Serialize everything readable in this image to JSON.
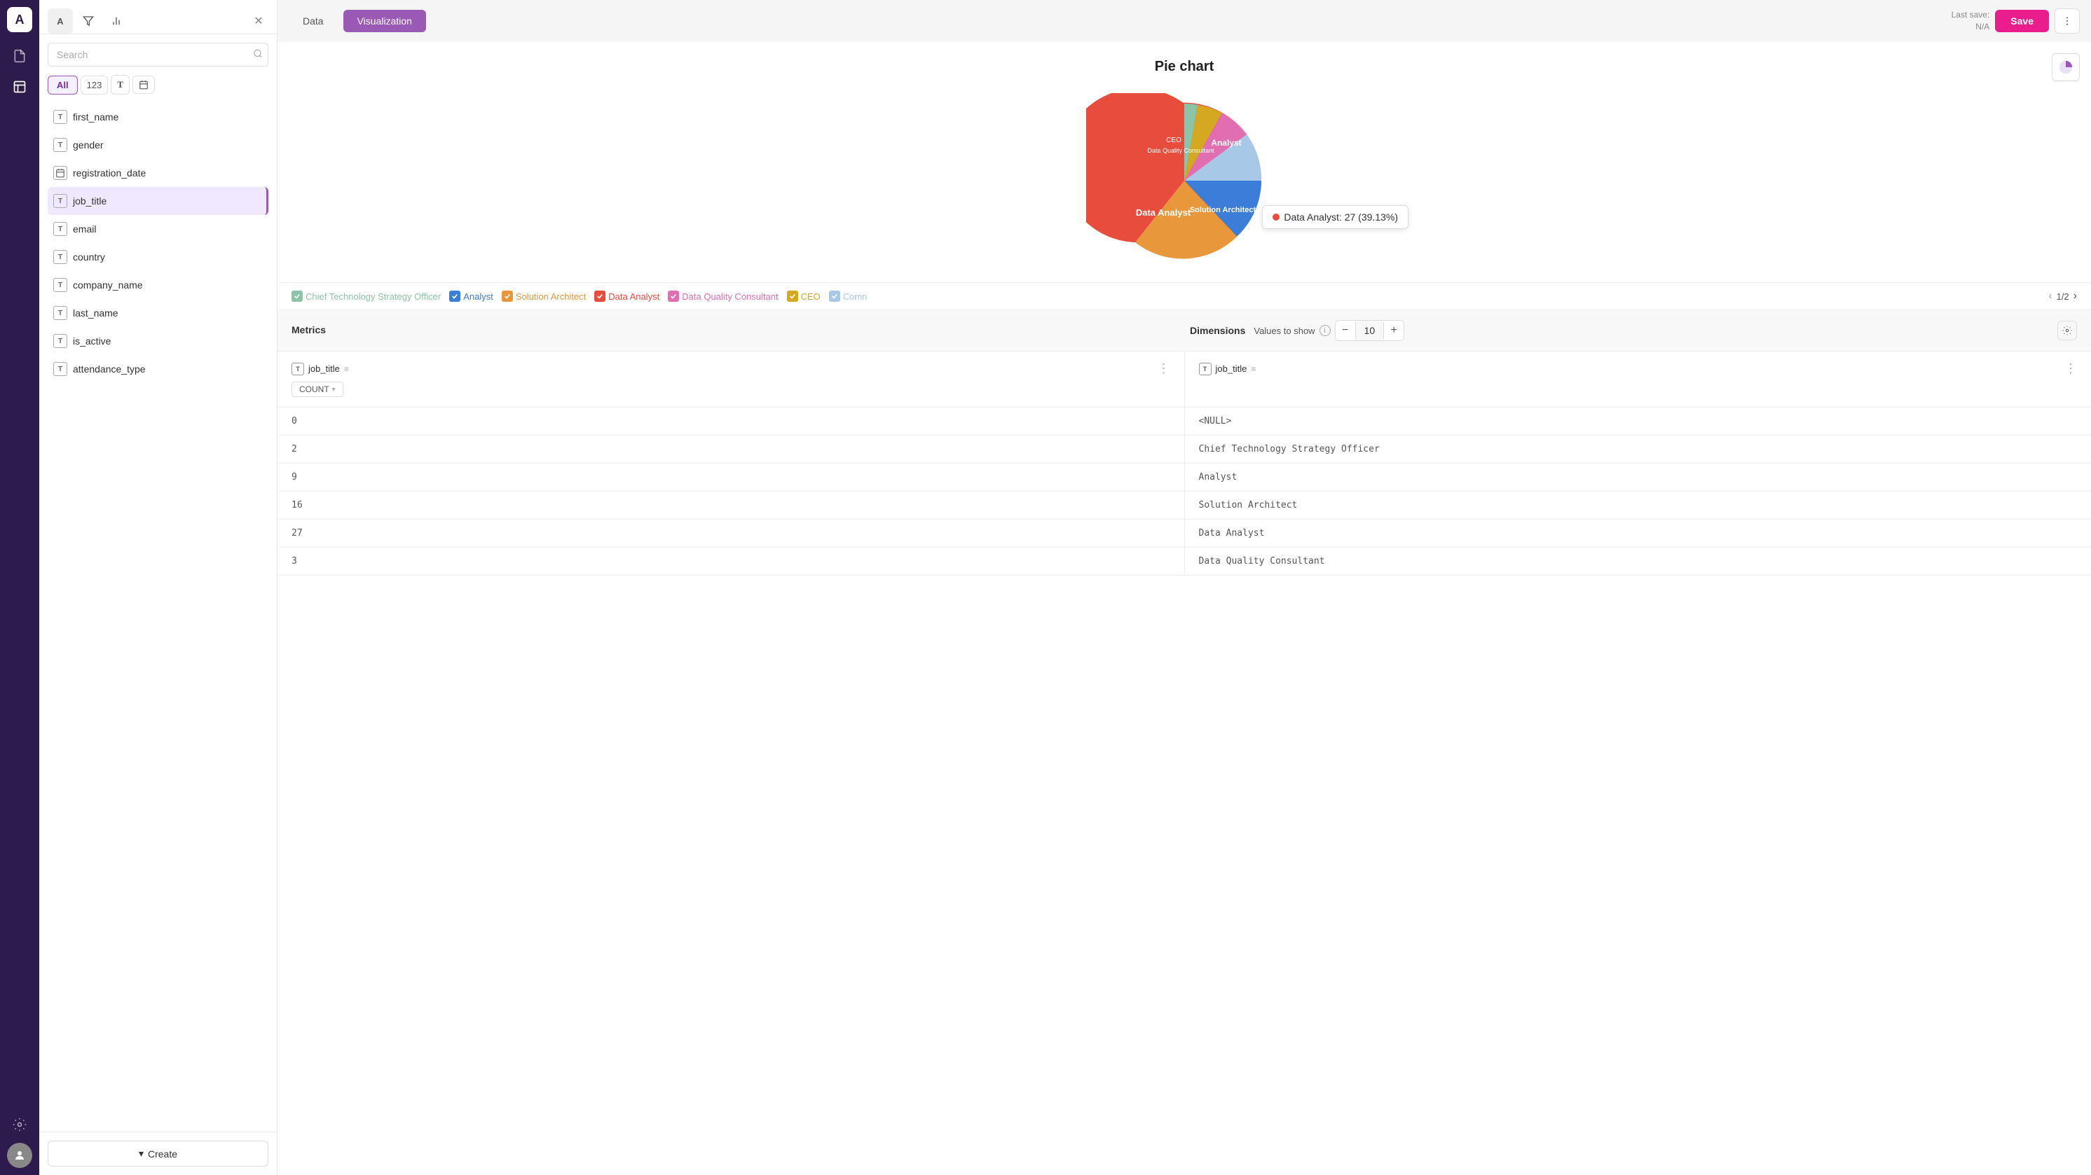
{
  "app": {
    "logo": "A"
  },
  "sidebar": {
    "search_placeholder": "Search",
    "filter_tabs": [
      {
        "label": "All",
        "active": true
      },
      {
        "label": "123",
        "type": "number"
      },
      {
        "label": "T",
        "type": "text"
      },
      {
        "label": "📅",
        "type": "date"
      }
    ],
    "fields": [
      {
        "name": "first_name",
        "type": "T"
      },
      {
        "name": "gender",
        "type": "T"
      },
      {
        "name": "registration_date",
        "type": "date"
      },
      {
        "name": "job_title",
        "type": "T",
        "selected": true
      },
      {
        "name": "email",
        "type": "T"
      },
      {
        "name": "country",
        "type": "T"
      },
      {
        "name": "company_name",
        "type": "T"
      },
      {
        "name": "last_name",
        "type": "T"
      },
      {
        "name": "is_active",
        "type": "T"
      },
      {
        "name": "attendance_type",
        "type": "T"
      }
    ],
    "create_label": "Create"
  },
  "topbar": {
    "tabs": [
      {
        "label": "Data",
        "active": false
      },
      {
        "label": "Visualization",
        "active": true
      }
    ],
    "last_save_label": "Last save:",
    "last_save_value": "N/A",
    "save_label": "Save"
  },
  "chart": {
    "title": "Pie chart",
    "tooltip": "Data Analyst: 27 (39.13%)",
    "segments": [
      {
        "label": "Analyst",
        "color": "#3b7dd8",
        "percentage": 13
      },
      {
        "label": "Solution Architect",
        "color": "#e8973b",
        "percentage": 23
      },
      {
        "label": "Data Analyst",
        "color": "#e74c3c",
        "percentage": 39
      },
      {
        "label": "Data Quality Consultant",
        "color": "#e74c9e",
        "percentage": 7
      },
      {
        "label": "CEO",
        "color": "#c0a020",
        "percentage": 5
      },
      {
        "label": "Chief Technology Strategy Officer",
        "color": "#8bc4a8",
        "percentage": 3
      },
      {
        "label": "Comn",
        "color": "#b0c8e8",
        "percentage": 10
      }
    ],
    "legend": [
      {
        "label": "Chief Technology Strategy Officer",
        "color": "#8bc4a8",
        "checked": true
      },
      {
        "label": "Analyst",
        "color": "#3b7dd8",
        "checked": true
      },
      {
        "label": "Solution Architect",
        "color": "#e8973b",
        "checked": true
      },
      {
        "label": "Data Analyst",
        "color": "#e74c3c",
        "checked": true
      },
      {
        "label": "Data Quality Consultant",
        "color": "#e74c9e",
        "checked": true
      },
      {
        "label": "CEO",
        "color": "#c0a020",
        "checked": true
      },
      {
        "label": "Comn",
        "color": "#b0c8e8",
        "checked": true
      }
    ],
    "pagination": "1/2"
  },
  "metrics_panel": {
    "metrics_label": "Metrics",
    "dimensions_label": "Dimensions",
    "values_to_show_label": "Values to show",
    "values_count": "10",
    "metric_field": "job_title",
    "metric_agg": "COUNT",
    "dimension_field": "job_title",
    "rows": [
      {
        "metric": "0",
        "dimension": "<NULL>"
      },
      {
        "metric": "2",
        "dimension": "Chief Technology Strategy Officer"
      },
      {
        "metric": "9",
        "dimension": "Analyst"
      },
      {
        "metric": "16",
        "dimension": "Solution Architect"
      },
      {
        "metric": "27",
        "dimension": "Data Analyst"
      },
      {
        "metric": "3",
        "dimension": "Data Quality Consultant"
      }
    ]
  }
}
